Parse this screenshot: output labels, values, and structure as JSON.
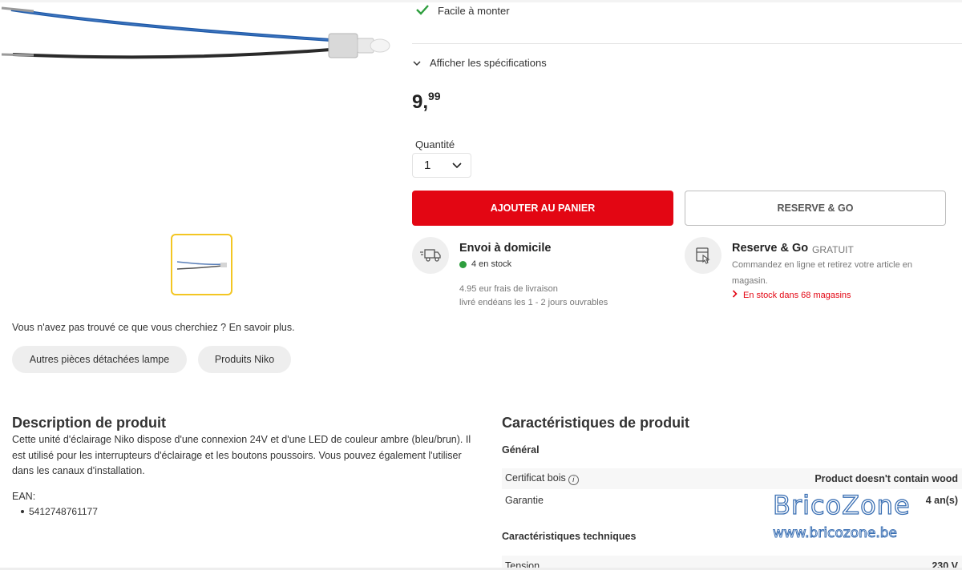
{
  "feature": {
    "label": "Facile à monter"
  },
  "specs_toggle": {
    "label": "Afficher les spécifications"
  },
  "price": {
    "integer": "9,",
    "decimal": "99"
  },
  "quantity": {
    "label": "Quantité",
    "value": "1"
  },
  "buttons": {
    "add_to_cart": "AJOUTER AU PANIER",
    "reserve": "RESERVE & GO"
  },
  "shipping": {
    "title": "Envoi à domicile",
    "stock": "4 en stock",
    "fee": "4.95 eur frais de livraison",
    "delay": "livré endéans les 1 - 2 jours ouvrables"
  },
  "reserve_go": {
    "title": "Reserve & Go",
    "badge": "GRATUIT",
    "description": "Commandez en ligne et retirez votre article en magasin.",
    "stock": "En stock dans 68 magasins"
  },
  "not_found": "Vous n'avez pas trouvé ce que vous cherchiez ? En savoir plus.",
  "chips": [
    "Autres pièces détachées lampe",
    "Produits Niko"
  ],
  "description": {
    "title": "Description de produit",
    "body": "Cette unité d'éclairage Niko dispose d'une connexion 24V et d'une LED de couleur ambre (bleu/brun). Il est utilisé pour les interrupteurs d'éclairage et les boutons poussoirs. Vous pouvez également l'utiliser dans les canaux d'installation.",
    "ean_label": "EAN:",
    "ean_values": [
      "5412748761177"
    ]
  },
  "characteristics": {
    "title": "Caractéristiques de produit",
    "groups": [
      {
        "title": "Général",
        "rows": [
          {
            "label": "Certificat bois",
            "value": "Product doesn't contain wood"
          },
          {
            "label": "Garantie",
            "value": "4 an(s)"
          }
        ]
      },
      {
        "title": "Caractéristiques techniques",
        "rows": [
          {
            "label": "Tension",
            "value": "230 V"
          }
        ]
      }
    ]
  },
  "watermark": {
    "logo": "BricoZone",
    "url": "www.bricozone.be"
  },
  "colors": {
    "accent_red": "#e30613",
    "stock_green": "#2e9e3e",
    "thumb_border": "#f3c623",
    "watermark_blue": "#3a6fb3"
  }
}
